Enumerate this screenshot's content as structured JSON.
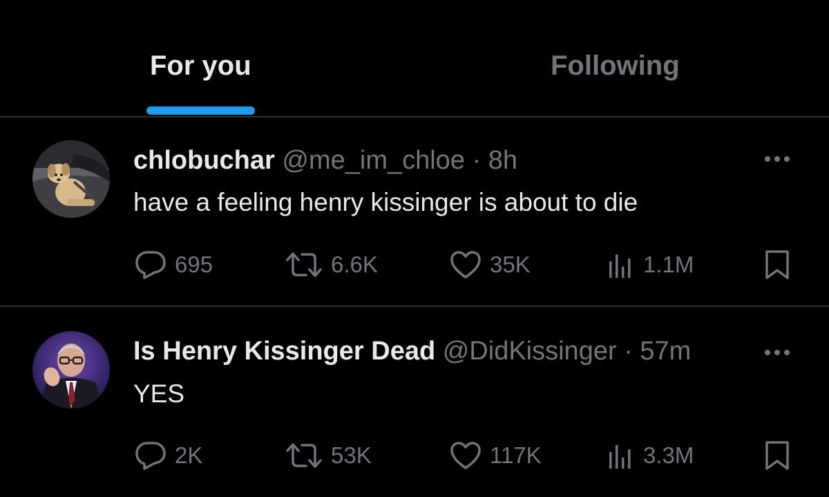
{
  "tabs": [
    {
      "label": "For you",
      "active": true
    },
    {
      "label": "Following",
      "active": false
    }
  ],
  "accent_color": "#1d9bf0",
  "tweets": [
    {
      "display_name": "chlobuchar",
      "handle": "@me_im_chloe",
      "separator": "·",
      "time": "8h",
      "text": "have a feeling henry kissinger is about to die",
      "avatar_icon": "dog-photo-avatar",
      "replies": "695",
      "retweets": "6.6K",
      "likes": "35K",
      "views": "1.1M"
    },
    {
      "display_name": "Is Henry Kissinger Dead",
      "handle": "@DidKissinger",
      "separator": "·",
      "time": "57m",
      "text": "YES",
      "avatar_icon": "kissinger-photo-avatar",
      "replies": "2K",
      "retweets": "53K",
      "likes": "117K",
      "views": "3.3M"
    }
  ],
  "icons": {
    "reply": "reply-icon",
    "retweet": "retweet-icon",
    "like": "heart-icon",
    "views": "views-icon",
    "bookmark": "bookmark-icon",
    "more": "more-icon"
  }
}
